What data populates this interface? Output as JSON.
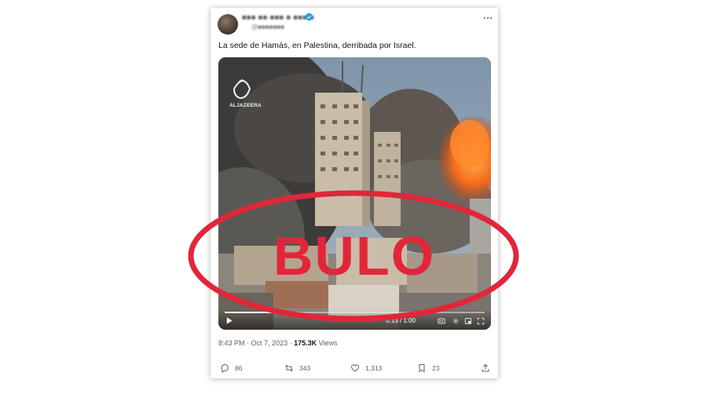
{
  "tweet": {
    "author_name": "■■■ ■■ ■■■ ■ ■■■ ■",
    "author_handle": "@■■■■■■■",
    "text": "La sede de Hamás, en Palestina, derribada por Israel.",
    "video": {
      "watermark": "ALJAZEERA",
      "time": "0:13 / 1:00",
      "progress": 0.21
    },
    "time": "8:43 PM",
    "date": "Oct 7, 2023",
    "views_count": "175.3K",
    "views_label": "Views",
    "stats": {
      "replies": "86",
      "retweets": "343",
      "likes": "1,313",
      "bookmarks": "23"
    }
  },
  "stamp": {
    "text": "BULO",
    "color": "#e2263a"
  },
  "icons": [
    "verified-badge-icon",
    "more-options-icon",
    "play-icon",
    "closed-captions-icon",
    "settings-icon",
    "fullscreen-icon",
    "reply-icon",
    "retweet-icon",
    "like-icon",
    "bookmark-icon",
    "share-icon"
  ]
}
